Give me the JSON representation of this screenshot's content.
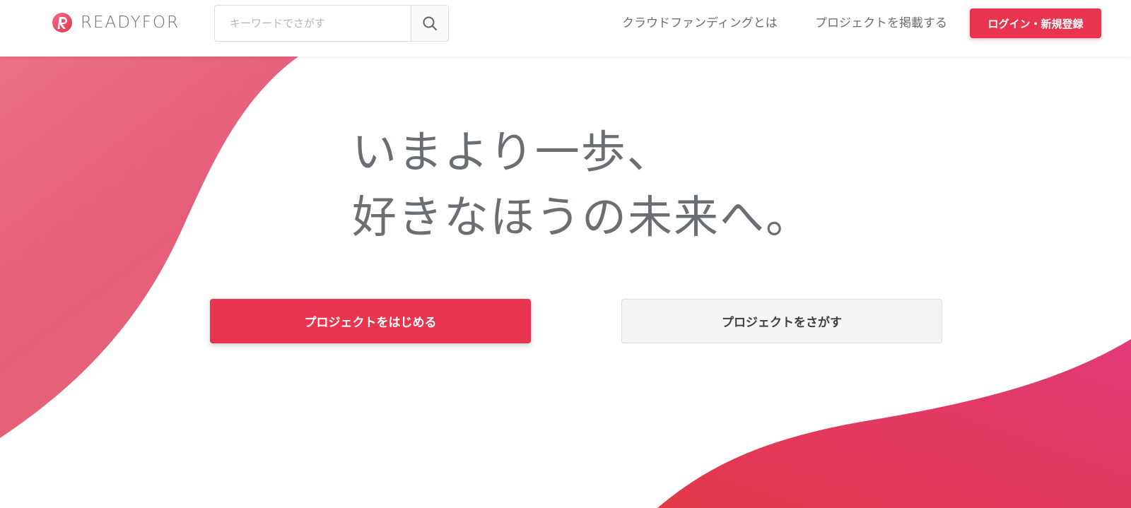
{
  "brand": {
    "name": "READYFOR",
    "accent_color": "#e8344e",
    "gradient_colors": [
      "#ec6b86",
      "#e8344e",
      "#e23a70"
    ]
  },
  "header": {
    "search": {
      "placeholder": "キーワードでさがす",
      "button_icon": "search-icon"
    },
    "nav": {
      "about_label": "クラウドファンディングとは",
      "post_label": "プロジェクトを掲載する"
    },
    "login_label": "ログイン・新規登録"
  },
  "hero": {
    "headline_line1": "いまより一歩、",
    "headline_line2": "好きなほうの未来へ。",
    "cta_primary": "プロジェクトをはじめる",
    "cta_secondary": "プロジェクトをさがす"
  }
}
